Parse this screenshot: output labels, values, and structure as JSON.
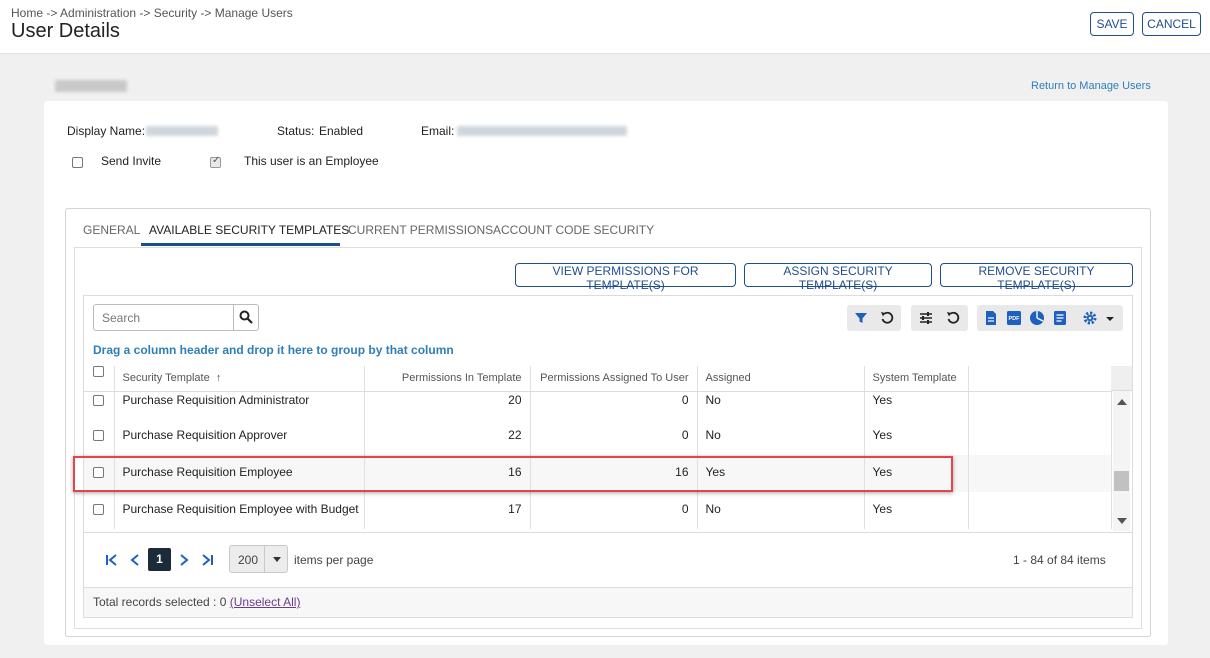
{
  "header": {
    "breadcrumb": "Home -> Administration -> Security -> Manage Users",
    "title": "User Details",
    "save_label": "SAVE",
    "cancel_label": "CANCEL"
  },
  "return_link": "Return to Manage Users",
  "user_form": {
    "display_name_label": "Display Name:",
    "status_label": "Status:",
    "status_value": "Enabled",
    "email_label": "Email:",
    "send_invite_label": "Send Invite",
    "send_invite_checked": false,
    "employee_label": "This user is an Employee",
    "employee_checked": true
  },
  "tabs": [
    {
      "label": "GENERAL",
      "active": false
    },
    {
      "label": "AVAILABLE SECURITY TEMPLATES",
      "active": true
    },
    {
      "label": "CURRENT PERMISSIONS",
      "active": false
    },
    {
      "label": "ACCOUNT CODE SECURITY",
      "active": false
    }
  ],
  "actions": {
    "view": "VIEW PERMISSIONS FOR TEMPLATE(S)",
    "assign": "ASSIGN SECURITY TEMPLATE(S)",
    "remove": "REMOVE SECURITY TEMPLATE(S)"
  },
  "search": {
    "placeholder": "Search",
    "value": ""
  },
  "group_hint": "Drag a column header and drop it here to group by that column",
  "columns": {
    "security_template": "Security Template",
    "sort_indicator": "↑",
    "permissions_in_template": "Permissions In Template",
    "permissions_assigned": "Permissions Assigned To User",
    "assigned": "Assigned",
    "system_template": "System Template"
  },
  "rows": [
    {
      "name": "Purchase Requisition Administrator",
      "in_template": "20",
      "assigned_count": "0",
      "assigned": "No",
      "system": "Yes"
    },
    {
      "name": "Purchase Requisition Approver",
      "in_template": "22",
      "assigned_count": "0",
      "assigned": "No",
      "system": "Yes"
    },
    {
      "name": "Purchase Requisition Employee",
      "in_template": "16",
      "assigned_count": "16",
      "assigned": "Yes",
      "system": "Yes"
    },
    {
      "name": "Purchase Requisition Employee with Budget",
      "in_template": "17",
      "assigned_count": "0",
      "assigned": "No",
      "system": "Yes"
    }
  ],
  "pager": {
    "current_page": "1",
    "page_size": "200",
    "items_per_page_label": "items per page",
    "items_count": "1 - 84 of 84 items"
  },
  "footer": {
    "total_selected": "Total records selected : 0",
    "unselect_all": "(Unselect All)"
  },
  "colors": {
    "accent": "#1f4e8c",
    "link": "#2d7fb8",
    "highlight_border": "#e0474c",
    "toolbar_icon": "#1f5fbf"
  }
}
